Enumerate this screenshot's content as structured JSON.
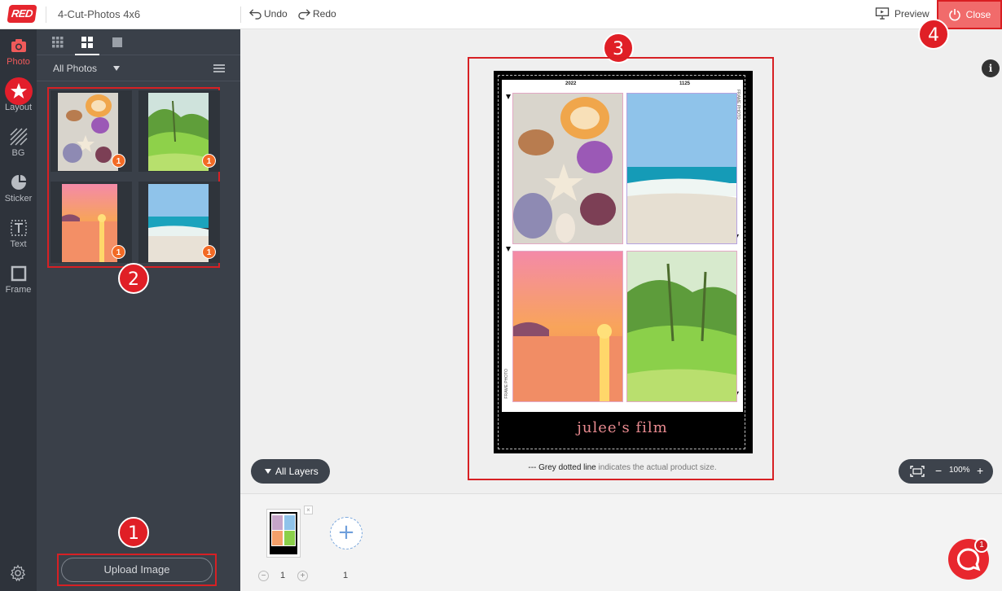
{
  "header": {
    "logo_text": "RED",
    "doc_title": "4-Cut-Photos 4x6",
    "undo_label": "Undo",
    "redo_label": "Redo",
    "preview_label": "Preview",
    "close_label": "Close"
  },
  "rail": {
    "items": [
      {
        "label": "Photo",
        "icon": "camera-icon",
        "active": true
      },
      {
        "label": "Layout",
        "icon": "star-icon"
      },
      {
        "label": "BG",
        "icon": "hatch-icon"
      },
      {
        "label": "Sticker",
        "icon": "sticker-icon"
      },
      {
        "label": "Text",
        "icon": "text-icon"
      },
      {
        "label": "Frame",
        "icon": "frame-icon"
      }
    ],
    "settings_icon": "gear-icon"
  },
  "panel": {
    "filter_label": "All Photos",
    "photos": [
      {
        "subject": "seashells",
        "count": "1"
      },
      {
        "subject": "palm-forest",
        "count": "1"
      },
      {
        "subject": "sunset",
        "count": "1"
      },
      {
        "subject": "beach",
        "count": "1"
      }
    ],
    "upload_label": "Upload Image"
  },
  "steps": [
    "1",
    "2",
    "3",
    "4"
  ],
  "canvas": {
    "year_left": "2022",
    "year_right": "1125",
    "caption": "julee's film",
    "side_text_top": "FRAME PHOTO",
    "side_text_bottom": "FRAME PHOTO",
    "note_prefix": "---",
    "note_bold": "Grey dotted line",
    "note_rest": "indicates the actual product size.",
    "info_label": "i",
    "layers_label": "All Layers",
    "zoom_minus": "−",
    "zoom_value": "100%",
    "zoom_plus": "+"
  },
  "pages": {
    "current": "1",
    "count": "1",
    "minus": "−",
    "plus": "+",
    "add_label": "+",
    "remove_label": "×"
  },
  "chat": {
    "badge": "1"
  },
  "colors": {
    "accent": "#e01f26",
    "panel": "#3a4049",
    "rail": "#2e333b",
    "badge": "#f26a25"
  }
}
